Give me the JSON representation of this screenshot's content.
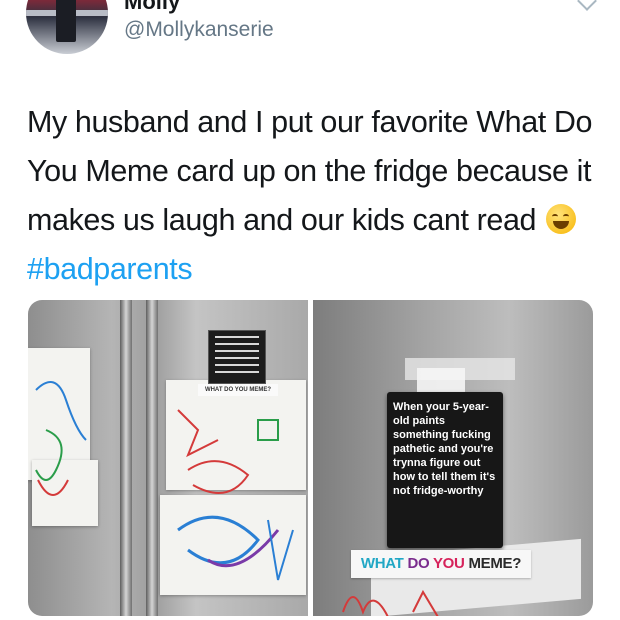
{
  "user": {
    "display_name": "Molly",
    "handle": "@Mollykanserie"
  },
  "tweet": {
    "text": "My husband and I put our favorite What Do You Meme card up on the fridge because it makes us laugh and our kids cant read",
    "emoji": "face-with-tears-of-joy",
    "hashtag": "#badparents"
  },
  "photos": {
    "left": {
      "small_label": "WHAT DO YOU MEME?"
    },
    "right": {
      "card_text": "When your 5-year-old paints something fucking pathetic and you're trynna figure out how to tell them it's not fridge-worthy",
      "banner": {
        "w1": "WHAT",
        "w2": "DO",
        "w3": "YOU",
        "w4": "MEME?"
      }
    }
  },
  "colors": {
    "hashtag": "#1da1f2",
    "handle": "#657786",
    "banner_what": "#21a7c5",
    "banner_do": "#7a2c8d",
    "banner_you": "#d6235b"
  }
}
